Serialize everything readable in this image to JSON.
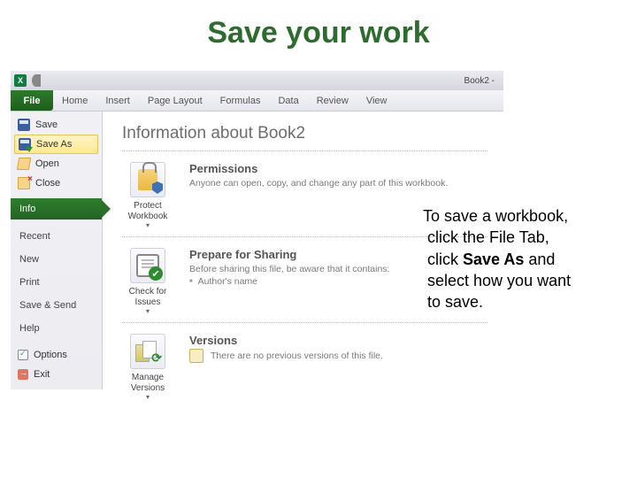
{
  "slide_title": "Save your work",
  "titlebar": {
    "book_label": "Book2 -",
    "xl_glyph": "X"
  },
  "ribbon": {
    "file": "File",
    "tabs": [
      "Home",
      "Insert",
      "Page Layout",
      "Formulas",
      "Data",
      "Review",
      "View"
    ]
  },
  "sidebar": {
    "save": "Save",
    "save_as": "Save As",
    "open": "Open",
    "close": "Close",
    "info": "Info",
    "recent": "Recent",
    "new": "New",
    "print": "Print",
    "save_send": "Save & Send",
    "help": "Help",
    "options": "Options",
    "exit": "Exit"
  },
  "info_pane": {
    "heading": "Information about Book2",
    "permissions": {
      "title": "Permissions",
      "desc": "Anyone can open, copy, and change any part of this workbook.",
      "btn": "Protect Workbook"
    },
    "prepare": {
      "title": "Prepare for Sharing",
      "desc": "Before sharing this file, be aware that it contains:",
      "bullet1": "Author's name",
      "btn": "Check for Issues"
    },
    "versions": {
      "title": "Versions",
      "desc": "There are no previous versions of this file.",
      "btn": "Manage Versions"
    }
  },
  "explainer": {
    "l1": "To save a workbook,",
    "l2a": "click the File Tab,",
    "l2b": "click ",
    "bold": "Save As",
    "l2c": " and",
    "l3": "select how you want",
    "l4": "to save."
  }
}
